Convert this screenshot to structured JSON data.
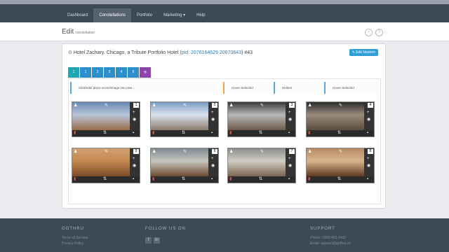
{
  "nav": {
    "items": [
      "Dashboard",
      "Constellations",
      "Portfolio",
      "Marketing ▾",
      "Help"
    ],
    "active_index": 1
  },
  "header": {
    "title": "Edit",
    "subtitle": "constellation",
    "back_icon": "arrow-left-icon",
    "help_icon": "question-icon"
  },
  "panel": {
    "hotel_prefix": "Hotel Zachary, Chicago, a Tribute Portfolio Hotel (",
    "hotel_pid": "pid: 2076164629 20070643",
    "hotel_suffix": ") #43",
    "edit_main": "Edit Neutron",
    "tabs": [
      "1",
      "1",
      "2",
      "3",
      "4",
      "5",
      "+"
    ],
    "lanes": [
      {
        "label": "Click/edit/ place scene/image into new ↓"
      },
      {
        "label": "Hover Selected"
      },
      {
        "label": "Hidden"
      },
      {
        "label": "Hover Selected"
      }
    ],
    "tiles": [
      {
        "num": "1",
        "colors": [
          "#6a88b4",
          "#b8c6d8",
          "#9a6b48"
        ]
      },
      {
        "num": "2",
        "colors": [
          "#7b9bc3",
          "#d9e3ee",
          "#887a6c"
        ]
      },
      {
        "num": "3",
        "colors": [
          "#3a3a3a",
          "#b7b7b7",
          "#6c5a4a"
        ]
      },
      {
        "num": "4",
        "colors": [
          "#2c2c2c",
          "#9a8c7c",
          "#5a4c3c"
        ]
      },
      {
        "num": "5",
        "colors": [
          "#d0a070",
          "#c4894f",
          "#7a4a28"
        ]
      },
      {
        "num": "6",
        "colors": [
          "#7c8a92",
          "#c7c4bd",
          "#6a4a30"
        ]
      },
      {
        "num": "7",
        "colors": [
          "#8c8c8c",
          "#d0ccc2",
          "#7a6450"
        ]
      },
      {
        "num": "8",
        "colors": [
          "#b48a66",
          "#d9b48a",
          "#5c3a22"
        ]
      }
    ]
  },
  "footer": {
    "col1": {
      "title": "GOTHRU",
      "links": [
        "Terms of Service",
        "Privacy Policy"
      ]
    },
    "col2": {
      "title": "FOLLOW US ON",
      "icons": [
        "facebook-icon",
        "linkedin-icon"
      ],
      "glyphs": [
        "f",
        "in"
      ]
    },
    "col3": {
      "title": "SUPPORT",
      "lines": [
        "Phone: 1800-401-2432",
        "Email: support@gothru.co"
      ]
    }
  }
}
